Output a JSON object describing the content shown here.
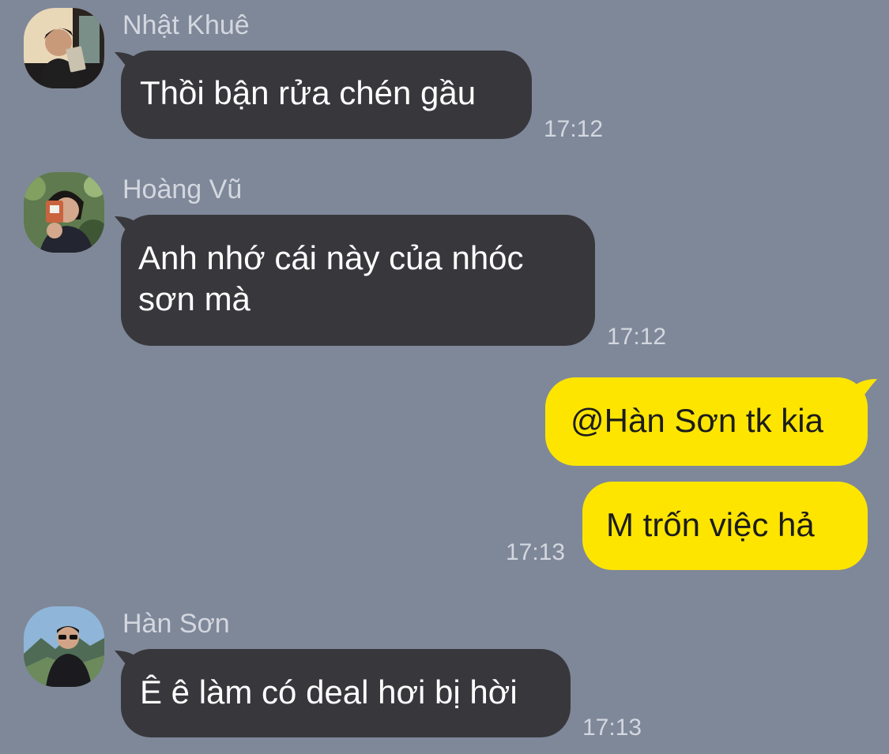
{
  "colors": {
    "background": "#7f8899",
    "incoming_bubble": "#38383c",
    "outgoing_bubble": "#fde500",
    "meta_text": "#d3d7df"
  },
  "messages": [
    {
      "sender": "Nhật Khuê",
      "text": "Thồi bận rửa chén gầu",
      "time": "17:12"
    },
    {
      "sender": "Hoàng Vũ",
      "line1": "Anh nhớ cái này của nhóc",
      "line2": "sơn mà",
      "time": "17:12"
    },
    {
      "text": "@Hàn Sơn tk kia"
    },
    {
      "text": "M trốn việc hả",
      "time": "17:13"
    },
    {
      "sender": "Hàn Sơn",
      "text": "Ê ê làm có deal hơi bị hời",
      "time": "17:13"
    }
  ],
  "icons": {
    "avatar_1": "person-reading-book-avatar",
    "avatar_2": "person-with-camera-avatar",
    "avatar_3": "person-sunglasses-mountain-avatar"
  }
}
